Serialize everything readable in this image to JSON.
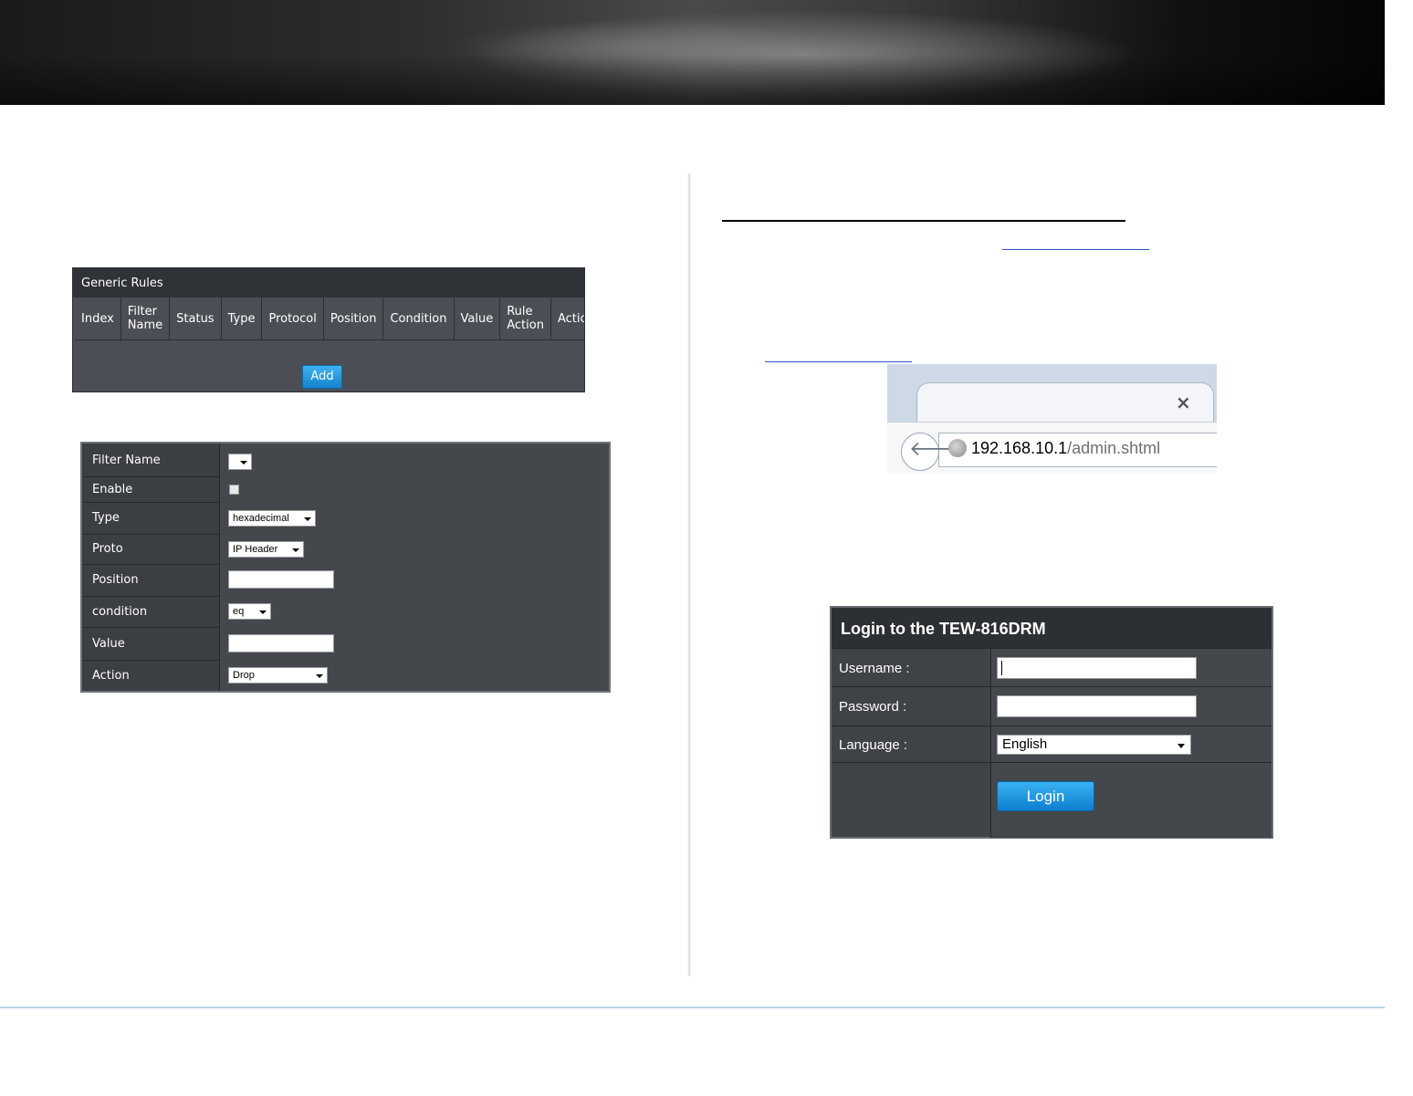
{
  "generic_rules": {
    "title": "Generic Rules",
    "columns": [
      {
        "l1": "Index",
        "l2": ""
      },
      {
        "l1": "Filter",
        "l2": "Name"
      },
      {
        "l1": "Status",
        "l2": ""
      },
      {
        "l1": "Type",
        "l2": ""
      },
      {
        "l1": "Protocol",
        "l2": ""
      },
      {
        "l1": "Position",
        "l2": ""
      },
      {
        "l1": "Condition",
        "l2": ""
      },
      {
        "l1": "Value",
        "l2": ""
      },
      {
        "l1": "Rule",
        "l2": "Action"
      },
      {
        "l1": "Action",
        "l2": ""
      }
    ],
    "add_label": "Add"
  },
  "filter_form": {
    "filter_name": {
      "label": "Filter Name",
      "value": ""
    },
    "enable": {
      "label": "Enable",
      "checked": false
    },
    "type": {
      "label": "Type",
      "value": "hexadecimal"
    },
    "proto": {
      "label": "Proto",
      "value": "IP Header"
    },
    "position": {
      "label": "Position",
      "value": ""
    },
    "condition": {
      "label": "condition",
      "value": "eq"
    },
    "value": {
      "label": "Value",
      "value": ""
    },
    "action": {
      "label": "Action",
      "value": "Drop"
    }
  },
  "browser": {
    "url_host": "192.168.10.1",
    "url_path": "/admin.shtml"
  },
  "login": {
    "title": "Login to the TEW-816DRM",
    "username_label": "Username :",
    "username_value": "",
    "password_label": "Password :",
    "password_value": "",
    "language_label": "Language :",
    "language_value": "English",
    "login_label": "Login"
  },
  "colors": {
    "accent_button": "#1583cc",
    "panel_bg": "#3b3e43",
    "link": "#2b55cc"
  }
}
